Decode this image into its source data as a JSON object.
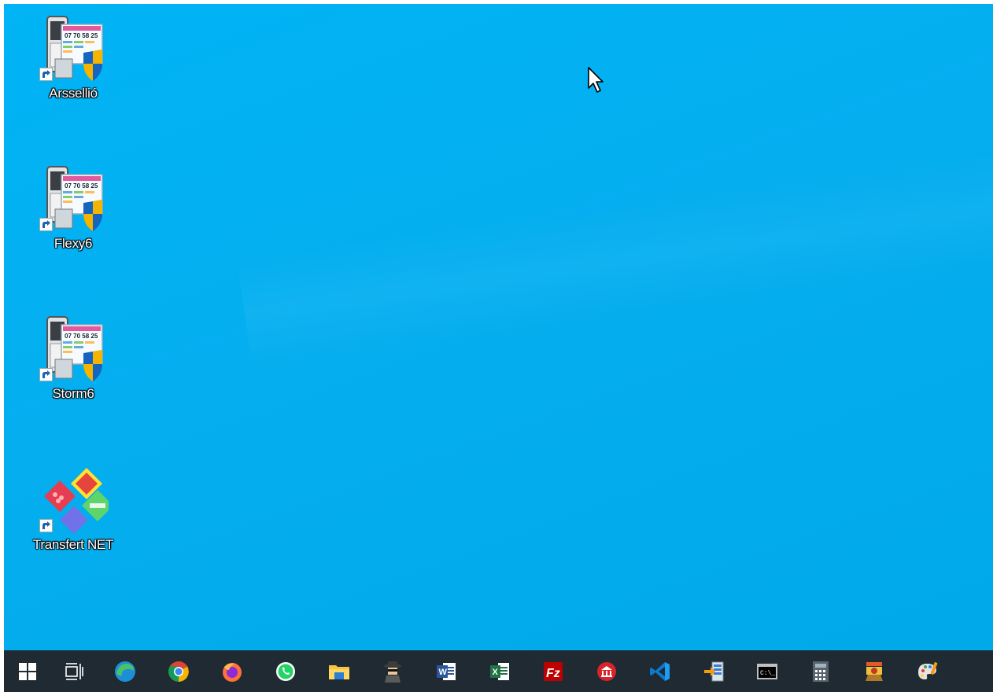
{
  "desktop": {
    "icons": [
      {
        "label": "Arssellió",
        "icon": "phone-terminal-shield-icon"
      },
      {
        "label": "Flexy6",
        "icon": "phone-terminal-shield-icon"
      },
      {
        "label": "Storm6",
        "icon": "phone-terminal-shield-icon"
      },
      {
        "label": "Transfert NET",
        "icon": "colored-diamonds-icon"
      }
    ],
    "background_color": "#00b0f2"
  },
  "taskbar": {
    "background_color": "#1f2a32",
    "items": [
      {
        "icon": "windows-start-icon"
      },
      {
        "icon": "task-view-icon"
      },
      {
        "icon": "edge-icon"
      },
      {
        "icon": "chrome-icon"
      },
      {
        "icon": "firefox-icon"
      },
      {
        "icon": "whatsapp-icon"
      },
      {
        "icon": "file-explorer-icon"
      },
      {
        "icon": "spy-agent-icon"
      },
      {
        "icon": "word-icon"
      },
      {
        "icon": "excel-icon"
      },
      {
        "icon": "filezilla-icon"
      },
      {
        "icon": "bank-icon"
      },
      {
        "icon": "vscode-icon"
      },
      {
        "icon": "import-export-icon"
      },
      {
        "icon": "command-prompt-icon"
      },
      {
        "icon": "calculator-icon"
      },
      {
        "icon": "game-treasure-icon"
      },
      {
        "icon": "paint-icon"
      }
    ]
  }
}
